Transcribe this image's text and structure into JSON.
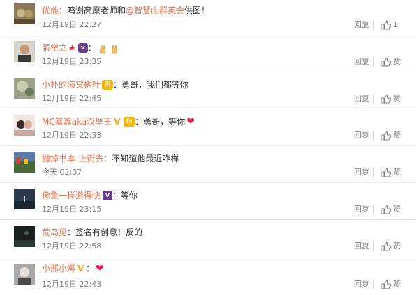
{
  "ui": {
    "reply_label": "回复",
    "like_label": "赞"
  },
  "comments": [
    {
      "user": "优雌",
      "text_prefix": "：鸣谢高原老师和 ",
      "mention": "@智慧山群英会",
      "text_suffix": " 供图！",
      "time": "12月19日 22:27",
      "like_count": "1"
    },
    {
      "user": "張常立",
      "text": "",
      "time": "12月19日 23:35",
      "like_count": ""
    },
    {
      "user": "小朴的海棠树叶",
      "text": "：勇哥，我们都等你",
      "time": "12月19日 22:45",
      "like_count": ""
    },
    {
      "user": "MC鑫鑫aka汉堡王",
      "text": "：勇哥，等你",
      "time": "12月19日 22:33",
      "like_count": ""
    },
    {
      "user": "抛掉书本-上街去",
      "text": "：不知道他最近咋样",
      "time": "今天 02:07",
      "like_count": ""
    },
    {
      "user": "像鱼一样游得快",
      "text": "：等你",
      "time": "12月19日 23:15",
      "like_count": ""
    },
    {
      "user": "荒岛见",
      "text": "：签名有创意！反的",
      "time": "12月19日 22:58",
      "like_count": ""
    },
    {
      "user": "小邢小寓",
      "text": "：",
      "time": "12月19日 22:43",
      "like_count": ""
    }
  ],
  "colors": {
    "username": "#eb7350",
    "meta": "#808080",
    "text": "#333333"
  }
}
